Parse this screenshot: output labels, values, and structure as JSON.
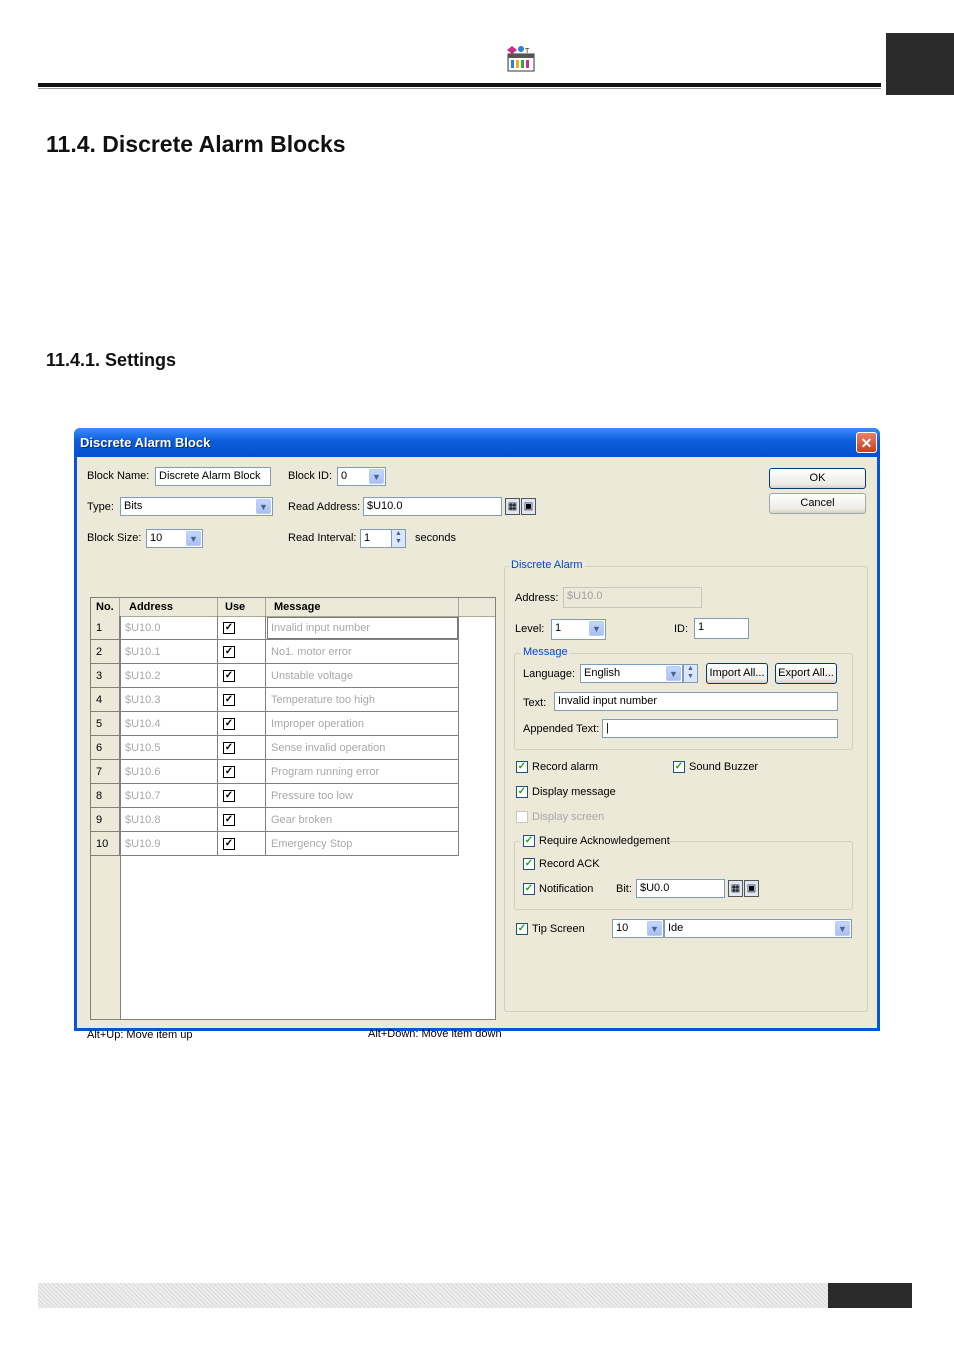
{
  "page": {
    "section_title": "11.4.  Discrete Alarm Blocks",
    "subsection_title": "11.4.1. Settings"
  },
  "dialog": {
    "title": "Discrete Alarm Block",
    "close_label": "✕",
    "block_name_label": "Block Name:",
    "block_name_value": "Discrete Alarm Block",
    "block_id_label": "Block ID:",
    "block_id_value": "0",
    "type_label": "Type:",
    "type_value": "Bits",
    "read_address_label": "Read Address:",
    "read_address_value": "$U10.0",
    "block_size_label": "Block Size:",
    "block_size_value": "10",
    "read_interval_label": "Read Interval:",
    "read_interval_value": "1",
    "seconds_label": "seconds",
    "ok_label": "OK",
    "cancel_label": "Cancel",
    "table": {
      "headers": [
        "No.",
        "Address",
        "Use",
        "Message"
      ],
      "rows": [
        {
          "no": "1",
          "address": "$U10.0",
          "message": "Invalid input number"
        },
        {
          "no": "2",
          "address": "$U10.1",
          "message": "No1. motor error"
        },
        {
          "no": "3",
          "address": "$U10.2",
          "message": "Unstable voltage"
        },
        {
          "no": "4",
          "address": "$U10.3",
          "message": "Temperature too high"
        },
        {
          "no": "5",
          "address": "$U10.4",
          "message": "Improper operation"
        },
        {
          "no": "6",
          "address": "$U10.5",
          "message": "Sense invalid operation"
        },
        {
          "no": "7",
          "address": "$U10.6",
          "message": "Program running error"
        },
        {
          "no": "8",
          "address": "$U10.7",
          "message": "Pressure too low"
        },
        {
          "no": "9",
          "address": "$U10.8",
          "message": "Gear broken"
        },
        {
          "no": "10",
          "address": "$U10.9",
          "message": "Emergency Stop"
        }
      ]
    },
    "hint_up": "Alt+Up: Move item up",
    "hint_down": "Alt+Down: Move item down",
    "discrete_alarm": {
      "group_title": "Discrete Alarm",
      "address_label": "Address:",
      "address_value": "$U10.0",
      "level_label": "Level:",
      "level_value": "1",
      "id_label": "ID:",
      "id_value": "1",
      "message_group_title": "Message",
      "language_label": "Language:",
      "language_value": "English",
      "import_all_label": "Import All...",
      "export_all_label": "Export All...",
      "text_label": "Text:",
      "text_value": "Invalid input number",
      "appended_text_label": "Appended Text:",
      "appended_text_value": "|",
      "record_alarm_label": "Record alarm",
      "sound_buzzer_label": "Sound Buzzer",
      "display_message_label": "Display message",
      "display_screen_label": "Display screen",
      "require_ack_label": "Require Acknowledgement",
      "record_ack_label": "Record ACK",
      "notification_label": "Notification",
      "bit_label": "Bit:",
      "bit_value": "$U0.0",
      "tip_screen_label": "Tip Screen",
      "tip_screen_no": "10",
      "tip_screen_name": "Ide"
    }
  }
}
